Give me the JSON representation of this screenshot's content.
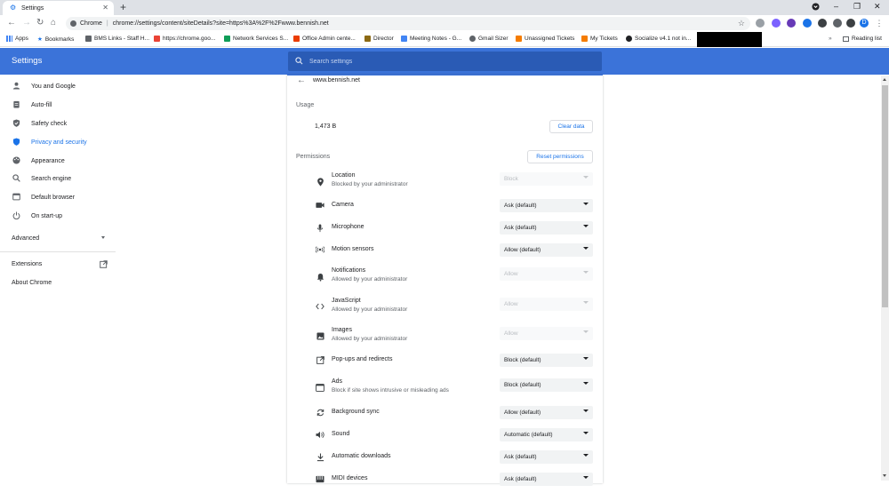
{
  "browser": {
    "tab_title": "Settings",
    "omnibox_site": "Chrome",
    "omnibox_url": "chrome://settings/content/siteDetails?site=https%3A%2F%2Fwww.bennish.net",
    "profile_initial": "D"
  },
  "bookmarks": [
    {
      "label": "Apps",
      "color": "#4285f4"
    },
    {
      "label": "Bookmarks",
      "color": "#1a73e8"
    },
    {
      "label": "BMS Links - Staff H...",
      "color": "#5f6368"
    },
    {
      "label": "https://chrome.goo...",
      "color": "#ea4335"
    },
    {
      "label": "Network Services S...",
      "color": "#0f9d58"
    },
    {
      "label": "Office Admin cente...",
      "color": "#eb3c00"
    },
    {
      "label": "Director",
      "color": "#8b6914"
    },
    {
      "label": "Meeting Notes - G...",
      "color": "#4285f4"
    },
    {
      "label": "Gmail Sizer",
      "color": "#5f6368"
    },
    {
      "label": "Unassigned Tickets",
      "color": "#f57c00"
    },
    {
      "label": "My Tickets",
      "color": "#f57c00"
    },
    {
      "label": "Socialize v4.1 not in...",
      "color": "#202124"
    }
  ],
  "reading_list": "Reading list",
  "header": {
    "title": "Settings",
    "search_placeholder": "Search settings"
  },
  "sidebar": {
    "items": [
      {
        "label": "You and Google",
        "icon": "person-icon"
      },
      {
        "label": "Auto-fill",
        "icon": "clipboard-icon"
      },
      {
        "label": "Safety check",
        "icon": "shield-check-icon"
      },
      {
        "label": "Privacy and security",
        "icon": "shield-icon"
      },
      {
        "label": "Appearance",
        "icon": "palette-icon"
      },
      {
        "label": "Search engine",
        "icon": "search-icon"
      },
      {
        "label": "Default browser",
        "icon": "browser-icon"
      },
      {
        "label": "On start-up",
        "icon": "power-icon"
      }
    ],
    "advanced": "Advanced",
    "extensions": "Extensions",
    "about": "About Chrome",
    "active_color": "#1a73e8"
  },
  "site": {
    "title": "www.bennish.net",
    "usage_label": "Usage",
    "usage_value": "1,473 B",
    "clear_button": "Clear data",
    "permissions_label": "Permissions",
    "reset_button": "Reset permissions"
  },
  "permissions": [
    {
      "name": "Location",
      "sub": "Blocked by your administrator",
      "value": "Block",
      "disabled": true,
      "icon": "location-pin-icon"
    },
    {
      "name": "Camera",
      "sub": "",
      "value": "Ask (default)",
      "disabled": false,
      "icon": "camera-icon"
    },
    {
      "name": "Microphone",
      "sub": "",
      "value": "Ask (default)",
      "disabled": false,
      "icon": "microphone-icon"
    },
    {
      "name": "Motion sensors",
      "sub": "",
      "value": "Allow (default)",
      "disabled": false,
      "icon": "sensors-icon"
    },
    {
      "name": "Notifications",
      "sub": "Allowed by your administrator",
      "value": "Allow",
      "disabled": true,
      "icon": "bell-icon"
    },
    {
      "name": "JavaScript",
      "sub": "Allowed by your administrator",
      "value": "Allow",
      "disabled": true,
      "icon": "code-icon"
    },
    {
      "name": "Images",
      "sub": "Allowed by your administrator",
      "value": "Allow",
      "disabled": true,
      "icon": "image-icon"
    },
    {
      "name": "Pop-ups and redirects",
      "sub": "",
      "value": "Block (default)",
      "disabled": false,
      "icon": "popup-icon"
    },
    {
      "name": "Ads",
      "sub": "Block if site shows intrusive or misleading ads",
      "value": "Block (default)",
      "disabled": false,
      "icon": "ads-icon"
    },
    {
      "name": "Background sync",
      "sub": "",
      "value": "Allow (default)",
      "disabled": false,
      "icon": "sync-icon"
    },
    {
      "name": "Sound",
      "sub": "",
      "value": "Automatic (default)",
      "disabled": false,
      "icon": "speaker-icon"
    },
    {
      "name": "Automatic downloads",
      "sub": "",
      "value": "Ask (default)",
      "disabled": false,
      "icon": "download-icon"
    },
    {
      "name": "MIDI devices",
      "sub": "",
      "value": "Ask (default)",
      "disabled": false,
      "icon": "midi-icon"
    }
  ]
}
